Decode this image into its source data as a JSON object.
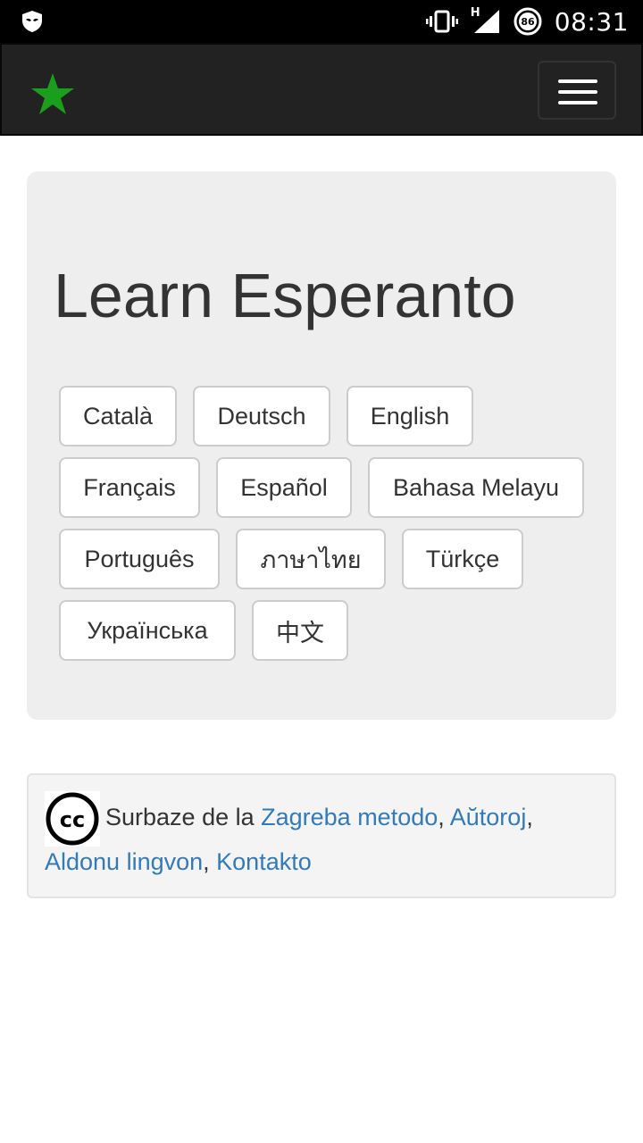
{
  "status_bar": {
    "time": "08:31",
    "network_type": "H",
    "battery_level": "86",
    "icons": [
      "shield-app-icon",
      "vibrate-icon",
      "signal-icon",
      "battery-icon"
    ]
  },
  "navbar": {
    "brand_icon": "green-star-icon",
    "brand_color": "#1b9e1b",
    "menu_icon": "hamburger-menu-icon"
  },
  "hero": {
    "title": "Learn Esperanto",
    "languages": [
      "Català",
      "Deutsch",
      "English",
      "Français",
      "Español",
      "Bahasa Melayu",
      "Português",
      "ภาษาไทย",
      "Türkçe",
      "Українська",
      "中文"
    ]
  },
  "footer": {
    "license_icon": "creative-commons-icon",
    "prefix_text": "Surbaze de la ",
    "links": {
      "zagreb": "Zagreba metodo",
      "authors": "Aŭtoroj",
      "add_language": "Aldonu lingvon",
      "contact": "Kontakto"
    },
    "separator": ", ",
    "trailing_comma": ","
  },
  "colors": {
    "link": "#337ab7",
    "navbar_bg": "#222222",
    "jumbotron_bg": "#eeeeee"
  }
}
